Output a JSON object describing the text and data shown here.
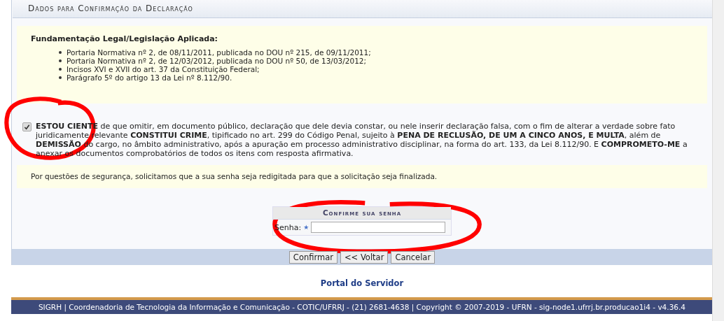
{
  "section_title": "Dados para Confirmação da Declaração",
  "legal_box": {
    "heading": "Fundamentação Legal/Legislação Aplicada:",
    "items": [
      "Portaria Normativa nº 2, de 08/11/2011, publicada no DOU nº 215, de 09/11/2011;",
      "Portaria Normativa nº 2, de 12/03/2012, publicada no DOU nº 50, de 13/03/2012;",
      "Incisos XVI e XVII do art. 37 da Constituição Federal;",
      "Parágrafo 5º do artigo 13 da Lei nº 8.112/90."
    ]
  },
  "declaration": {
    "checked": true,
    "text": "**ESTOU CIENTE** de que omitir, em documento público, declaração que dele devia constar, ou nele inserir declaração falsa, com o fim de alterar a verdade sobre fato juridicamente relevante **CONSTITUI CRIME**, tipificado no art. 299 do Código Penal, sujeito à **PENA DE RECLUSÃO, DE UM A CINCO ANOS, E MULTA**, além de **DEMISSÃO** do cargo, no âmbito administrativo, após a apuração em processo administrativo disciplinar, na forma do art. 133, da Lei 8.112/90. E **COMPROMETO-ME** a anexar os documentos comprobatórios de todos os itens com resposta afirmativa."
  },
  "security_notice": "Por questões de segurança, solicitamos que a sua senha seja redigitada para que a solicitação seja finalizada.",
  "password_form": {
    "title": "Confirme sua senha",
    "label": "Senha:",
    "required_mark": "★"
  },
  "buttons": [
    "Confirmar",
    "<< Voltar",
    "Cancelar"
  ],
  "portal_link": "Portal do Servidor",
  "footer": "SIGRH | Coordenadoria de Tecnologia da Informação e Comunicação - COTIC/UFRRJ - (21) 2681-4638 | Copyright © 2007-2019 - UFRN - sig-node1.ufrrj.br.producao1i4 - v4.36.4"
}
